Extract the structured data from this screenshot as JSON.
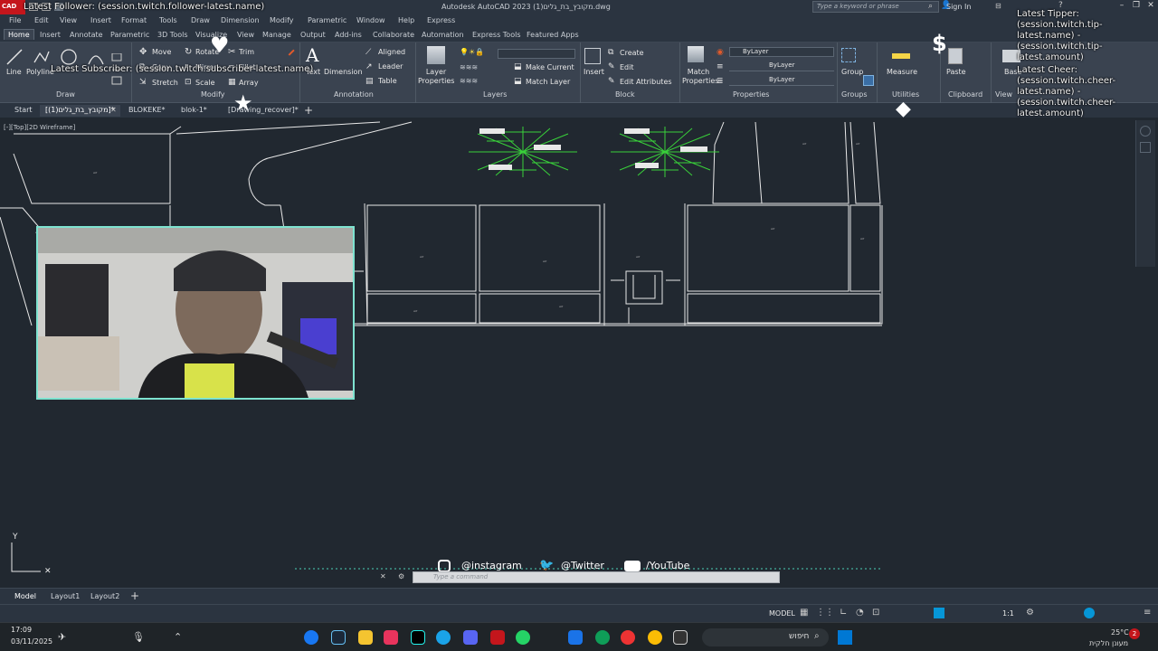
{
  "window": {
    "app_logo": "CAD",
    "title": "Autodesk AutoCAD 2023   מקובץ_בת_גלים(1).dwg",
    "search_placeholder": "Type a keyword or phrase",
    "sign_in": "Sign In"
  },
  "menubar": [
    "File",
    "Edit",
    "View",
    "Insert",
    "Format",
    "Tools",
    "Draw",
    "Dimension",
    "Modify",
    "Parametric",
    "Window",
    "Help",
    "Express"
  ],
  "ribbon_tabs": [
    "Home",
    "Insert",
    "Annotate",
    "Parametric",
    "3D Tools",
    "Visualize",
    "View",
    "Manage",
    "Output",
    "Add-ins",
    "Collaborate",
    "Automation",
    "Express Tools",
    "Featured Apps"
  ],
  "ribbon": {
    "draw": {
      "line": "Line",
      "polyline": "Polyline",
      "title": "Draw"
    },
    "modify": {
      "move": "Move",
      "rotate": "Rotate",
      "trim": "Trim",
      "copy": "Copy",
      "mirror": "Mirror",
      "fillet": "Fillet",
      "stretch": "Stretch",
      "scale": "Scale",
      "array": "Array",
      "title": "Modify"
    },
    "annotation": {
      "text": "Text",
      "dimension": "Dimension",
      "aligned": "Aligned",
      "leader": "Leader",
      "table": "Table",
      "title": "Annotation"
    },
    "layers": {
      "layer_properties": "Layer Properties",
      "make_current": "Make Current",
      "match_layer": "Match Layer",
      "title": "Layers"
    },
    "block": {
      "insert": "Insert",
      "create": "Create",
      "edit": "Edit",
      "edit_attributes": "Edit Attributes",
      "title": "Block"
    },
    "properties": {
      "match_properties": "Match Properties",
      "bylayer1": "ByLayer",
      "bylayer2": "ByLayer",
      "bylayer3": "ByLayer",
      "title": "Properties"
    },
    "groups": {
      "group": "Group",
      "title": "Groups"
    },
    "utilities": {
      "measure": "Measure",
      "title": "Utilities"
    },
    "clipboard": {
      "paste": "Paste",
      "title": "Clipboard"
    },
    "view": {
      "base": "Base",
      "title": "View"
    }
  },
  "file_tabs": [
    "Start",
    "[מקובץ_בת_גלים(1)]*",
    "BLOKEKE*",
    "blok-1*",
    "[Drawing_recover]*"
  ],
  "viewport_label": "[-][Top][2D Wireframe]",
  "overlays": {
    "latest_follower": "Latest Follower: (session.twitch.follower-latest.name)",
    "latest_subscriber": "Latest Subscriber: (session.twitch.subscriber-latest.name)",
    "latest_tipper": "Latest Tipper: (session.twitch.tip-latest.name) - (session.twitch.tip-latest.amount)",
    "latest_cheer": "Latest Cheer: (session.twitch.cheer-latest.name) - (session.twitch.cheer-latest.amount)"
  },
  "social": {
    "instagram": "@instagram",
    "twitter": "@Twitter",
    "youtube": "/YouTube"
  },
  "command_placeholder": "Type a command",
  "layout_tabs": [
    "Model",
    "Layout1",
    "Layout2"
  ],
  "statusbar": {
    "model": "MODEL",
    "scale": "1:1"
  },
  "taskbar": {
    "time": "17:09",
    "date": "03/11/2025",
    "search": "חיפוש",
    "weather": "25°C",
    "weather_sub": "מעונן חלקית",
    "notifications": "2"
  },
  "colors": {
    "accent": "#0696d7",
    "autocad_red": "#c4161c",
    "tree_green": "#39d13a",
    "cam_border": "#7ee3d0"
  }
}
